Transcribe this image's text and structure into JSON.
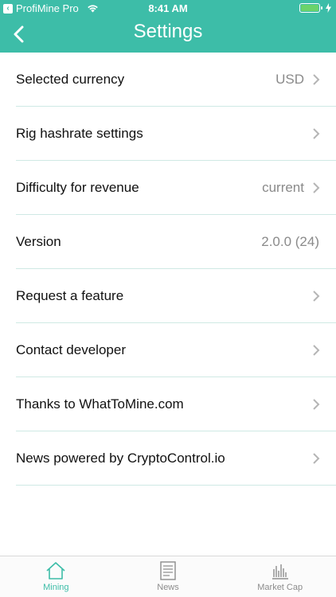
{
  "status_bar": {
    "back_app": "ProfiMine Pro",
    "time": "8:41 AM"
  },
  "header": {
    "title": "Settings",
    "color": "#3dbda8"
  },
  "settings": [
    {
      "label": "Selected currency",
      "value": "USD",
      "chevron": true
    },
    {
      "label": "Rig hashrate settings",
      "value": "",
      "chevron": true
    },
    {
      "label": "Difficulty for revenue",
      "value": "current",
      "chevron": true
    },
    {
      "label": "Version",
      "value": "2.0.0 (24)",
      "chevron": false
    },
    {
      "label": "Request a feature",
      "value": "",
      "chevron": true
    },
    {
      "label": "Contact developer",
      "value": "",
      "chevron": true
    },
    {
      "label": "Thanks to WhatToMine.com",
      "value": "",
      "chevron": true
    },
    {
      "label": "News powered by CryptoControl.io",
      "value": "",
      "chevron": true
    }
  ],
  "tabbar": {
    "tabs": [
      {
        "label": "Mining",
        "icon": "home-icon",
        "active": true
      },
      {
        "label": "News",
        "icon": "newspaper-icon",
        "active": false
      },
      {
        "label": "Market Cap",
        "icon": "bar-chart-icon",
        "active": false
      }
    ]
  }
}
